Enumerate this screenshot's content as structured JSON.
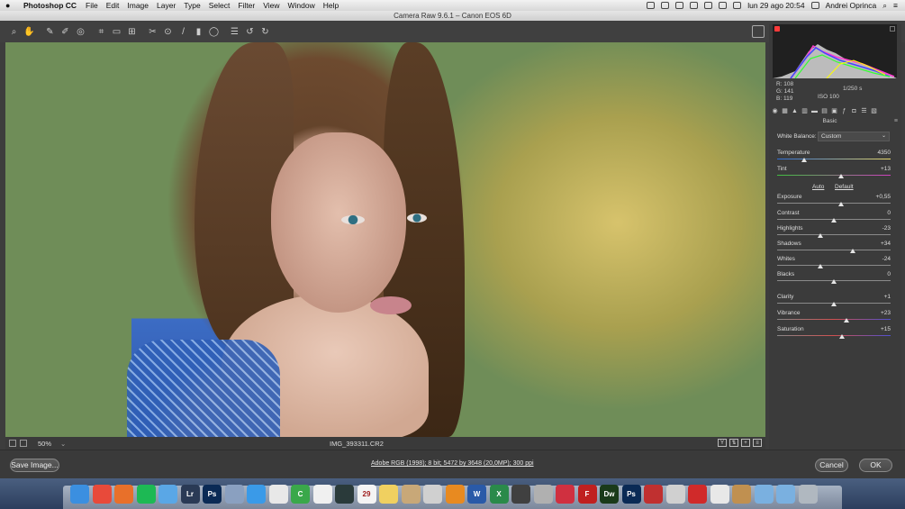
{
  "menubar": {
    "apple": "",
    "app_name": "Photoshop CC",
    "items": [
      "File",
      "Edit",
      "Image",
      "Layer",
      "Type",
      "Select",
      "Filter",
      "View",
      "Window",
      "Help"
    ],
    "datetime": "lun 29 ago  20:54",
    "user": "Andrei Oprinca"
  },
  "window": {
    "title": "Camera Raw 9.6.1  –  Canon EOS 6D"
  },
  "toolbar": {
    "tools": [
      "zoom-icon",
      "hand-icon",
      "white-balance-icon",
      "color-sampler-icon",
      "targeted-adjust-icon",
      "crop-icon",
      "straighten-icon",
      "transform-icon",
      "spot-removal-icon",
      "red-eye-icon",
      "adjustment-brush-icon",
      "graduated-filter-icon",
      "radial-filter-icon",
      "preferences-icon",
      "rotate-ccw-icon",
      "rotate-cw-icon"
    ]
  },
  "status": {
    "zoom": "50%",
    "filename": "IMG_393311.CR2",
    "view_y_label": "Y"
  },
  "bottom": {
    "save_label": "Save Image...",
    "workflow": "Adobe RGB (1998); 8 bit; 5472 by 3648 (20,0MP); 300 ppi",
    "cancel_label": "Cancel",
    "ok_label": "OK"
  },
  "info": {
    "r": "R:  108",
    "g": "G:  141",
    "b": "B:  119",
    "shutter": "1/250 s",
    "iso": "ISO 100"
  },
  "panel": {
    "title": "Basic",
    "wb_label": "White Balance:",
    "wb_value": "Custom",
    "auto": "Auto",
    "default": "Default",
    "sliders": [
      {
        "label": "Temperature",
        "value": "4350",
        "pos": 0.24
      },
      {
        "label": "Tint",
        "value": "+13",
        "pos": 0.56
      },
      {
        "label": "Exposure",
        "value": "+0,55",
        "pos": 0.56
      },
      {
        "label": "Contrast",
        "value": "0",
        "pos": 0.5
      },
      {
        "label": "Highlights",
        "value": "-23",
        "pos": 0.38
      },
      {
        "label": "Shadows",
        "value": "+34",
        "pos": 0.67
      },
      {
        "label": "Whites",
        "value": "-24",
        "pos": 0.38
      },
      {
        "label": "Blacks",
        "value": "0",
        "pos": 0.5
      },
      {
        "label": "Clarity",
        "value": "+1",
        "pos": 0.5
      },
      {
        "label": "Vibrance",
        "value": "+23",
        "pos": 0.61
      },
      {
        "label": "Saturation",
        "value": "+15",
        "pos": 0.57
      }
    ]
  },
  "colors": {
    "accent_red": "#ff3a3a",
    "panel_bg": "#3b3b3b"
  }
}
